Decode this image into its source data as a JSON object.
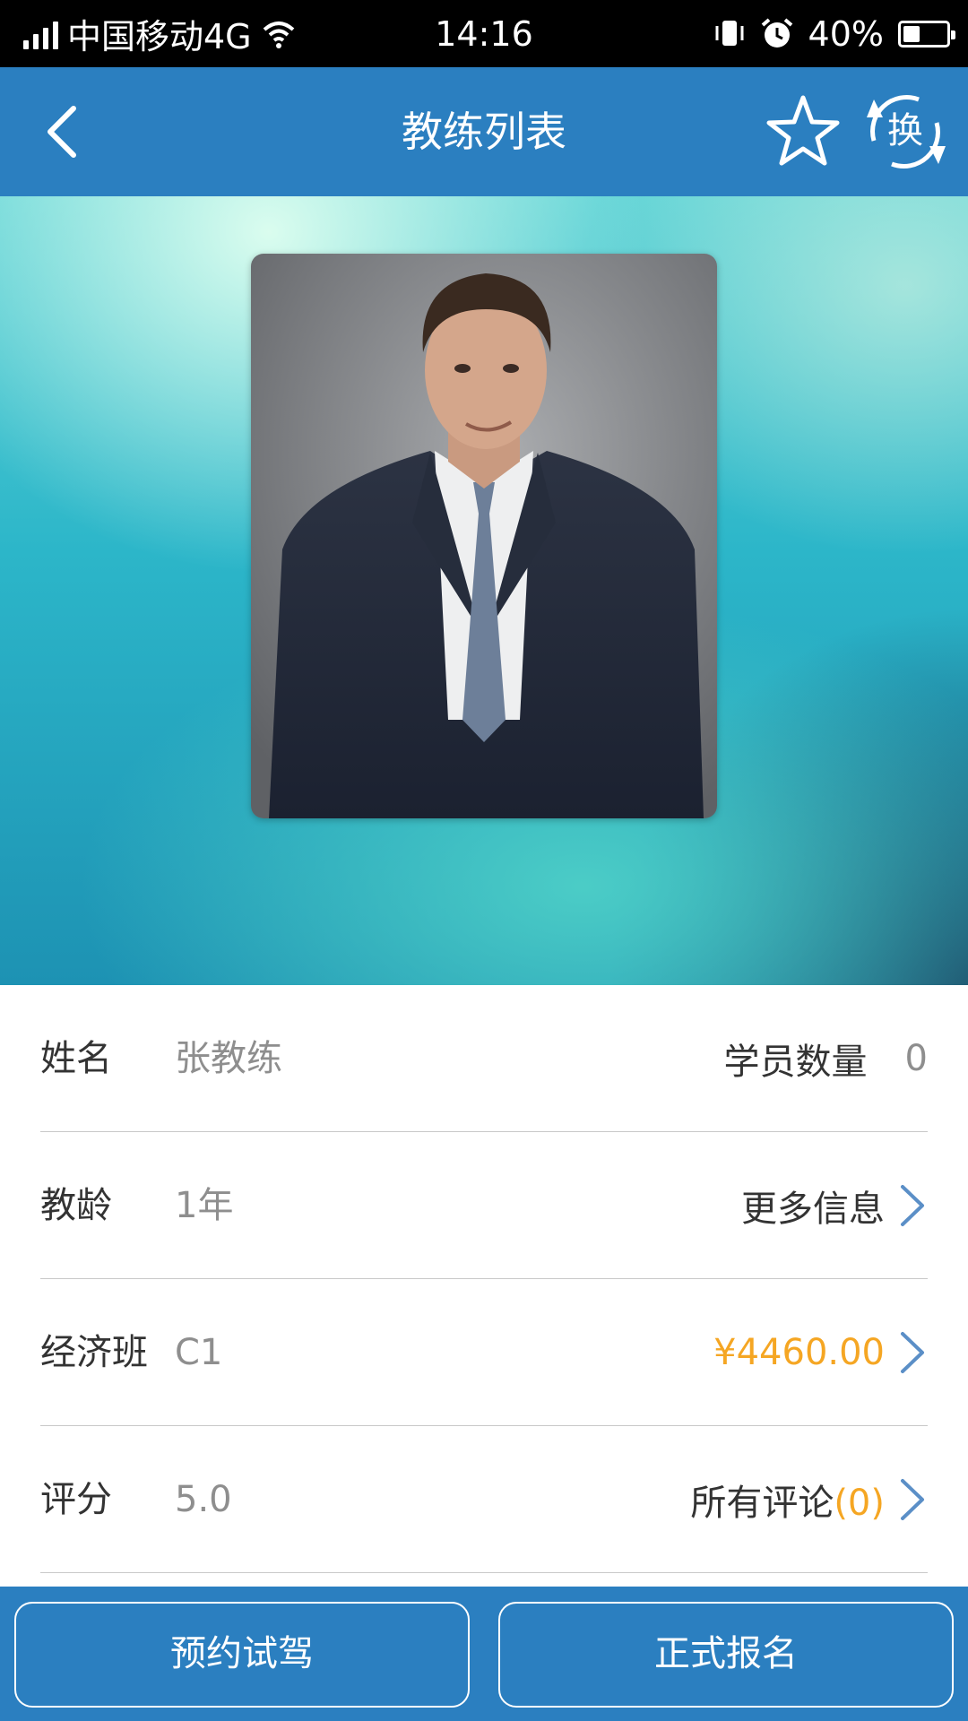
{
  "status_bar": {
    "carrier": "中国移动4G",
    "time": "14:16",
    "battery": "40%",
    "battery_level": 0.4
  },
  "nav": {
    "title": "教练列表",
    "back_icon": "chevron-left-icon",
    "favorite_icon": "star-outline-icon",
    "swap_icon": "swap-refresh-icon",
    "swap_label": "换"
  },
  "hero": {
    "photo": "coach-portrait"
  },
  "info": {
    "name_label": "姓名",
    "name_value": "张教练",
    "students_label": "学员数量",
    "students_value": "0",
    "years_label": "教龄",
    "years_value": "1年",
    "more_info_label": "更多信息",
    "class_label": "经济班",
    "class_value": "C1",
    "price": "¥4460.00",
    "rating_label": "评分",
    "rating_value": "5.0",
    "reviews_label": "所有评论",
    "reviews_count": "(0)"
  },
  "actions": {
    "trial_label": "预约试驾",
    "enroll_label": "正式报名"
  },
  "colors": {
    "primary": "#2b7fc0",
    "price": "#f5a623",
    "chevron": "#5b8fc7"
  }
}
